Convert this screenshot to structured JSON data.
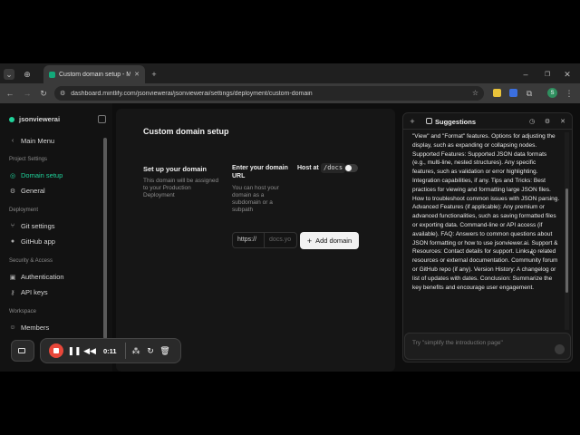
{
  "browser": {
    "tab_title": "Custom domain setup - Mintlif...",
    "url": "dashboard.mintlify.com/jsonviewerai/jsonviewerai/settings/deployment/custom-domain"
  },
  "sidebar": {
    "org_name": "jsonviewerai",
    "main_menu": "Main Menu",
    "sections": {
      "project_settings": "Project Settings",
      "deployment": "Deployment",
      "security_access": "Security & Access",
      "workspace": "Workspace"
    },
    "items": {
      "domain_setup": "Domain setup",
      "general": "General",
      "git_settings": "Git settings",
      "github_app": "GitHub app",
      "authentication": "Authentication",
      "api_keys": "API keys",
      "members": "Members"
    }
  },
  "main": {
    "page_title": "Custom domain setup",
    "setup_heading": "Set up your domain",
    "setup_desc": "This domain will be assigned to your Production Deployment",
    "enter_label": "Enter your domain URL",
    "enter_desc": "You can host your domain as a subdomain or a subpath",
    "host_at_label": "Host at",
    "host_at_code": "/docs",
    "prefix": "https://",
    "domain_placeholder": "docs.yo",
    "add_domain": "Add domain"
  },
  "suggestions": {
    "title": "Suggestions",
    "body": "\"View\" and \"Format\" features. Options for adjusting the display, such as expanding or collapsing nodes. Supported Features: Supported JSON data formats (e.g., multi-line, nested structures). Any specific features, such as validation or error highlighting. Integration capabilities, if any. Tips and Tricks: Best practices for viewing and formatting large JSON files. How to troubleshoot common issues with JSON parsing. Advanced Features (if applicable): Any premium or advanced functionalities, such as saving formatted files or exporting data. Command-line or API access (if available). FAQ: Answers to common questions about JSON formatting or how to use jsonviewer.ai. Support & Resources: Contact details for support. Links to related resources or external documentation. Community forum or GitHub repo (if any). Version History: A changelog or list of updates with dates. Conclusion: Summarize the key benefits and encourage user engagement.",
    "input_placeholder": "Try \"simplify the introduction page\""
  },
  "recorder": {
    "time": "0:11"
  },
  "colors": {
    "accent": "#1fd29a",
    "record_red": "#e8473a"
  }
}
